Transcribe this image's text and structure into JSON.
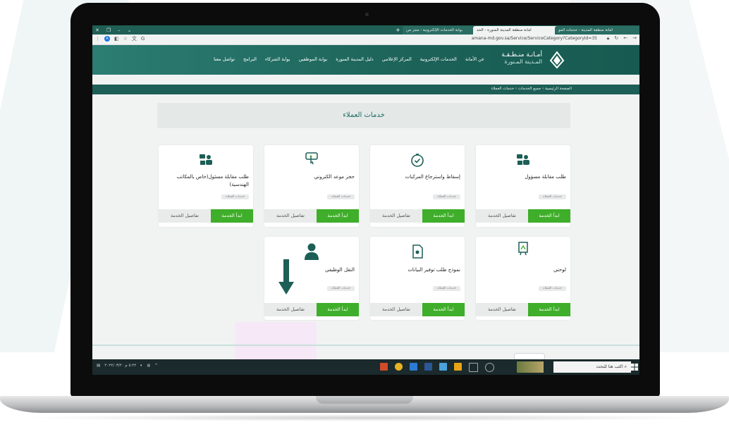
{
  "browser": {
    "tabs": [
      {
        "label": "امانة منطقة المدينة - خدمات المو",
        "active": false
      },
      {
        "label": "امانة منطقة المدينة المنورة - الخد",
        "active": true
      },
      {
        "label": "بوابة الخدمات الإلكترونية - مجز من",
        "active": false
      }
    ],
    "url": "amana-md.gov.sa/Service/ServiceCategory?CategoryId=35"
  },
  "header": {
    "logo_line1": "أمـانـة منـطـقـة",
    "logo_line2": "المـدينة المـنورة",
    "nav": [
      "عن الأمانة",
      "الخدمات الإلكترونية",
      "المركز الإعلامي",
      "دليل المدينة المنورة",
      "بوابة الموظفين",
      "بوابة الشركاء",
      "البرامج",
      "تواصل معنا"
    ]
  },
  "breadcrumb": "الصفحة الرئيسية  ›  جميع الخدمات  ›  خدمات العملاء",
  "page_title": "خدمات العملاء",
  "cards": [
    {
      "title": "طلب مقابلة مسؤول",
      "badge": "خدمات العملاء",
      "start": "ابدأ الخدمة",
      "details": "تفاصيل الخدمة",
      "icon": "people-icon"
    },
    {
      "title": "إسقاط واسترجاع المركبات",
      "badge": "خدمات العملاء",
      "start": "ابدأ الخدمة",
      "details": "تفاصيل الخدمة",
      "icon": "clock-check-icon"
    },
    {
      "title": "حجز موعد الكتروني",
      "badge": "خدمات العملاء",
      "start": "ابدأ الخدمة",
      "details": "تفاصيل الخدمة",
      "icon": "touch-screen-icon"
    },
    {
      "title": "طلب مقابلة مسئول(خاص بالمكاتب الهندسية)",
      "badge": "خدمات العملاء",
      "start": "ابدأ الخدمة",
      "details": "تفاصيل الخدمة",
      "icon": "people-icon"
    },
    {
      "title": "لوحتي",
      "badge": "خدمات العملاء",
      "start": "ابدأ الخدمة",
      "details": "تفاصيل الخدمة",
      "icon": "board-icon"
    },
    {
      "title": "نموذج طلب توفير البيانات",
      "badge": "خدمات العملاء",
      "start": "ابدأ الخدمة",
      "details": "تفاصيل الخدمة",
      "icon": "document-icon"
    },
    {
      "title": "النقل الوظيفي",
      "badge": "خدمات العملاء",
      "start": "ابدأ الخدمة",
      "details": "تفاصيل الخدمة",
      "icon": "person-icon"
    }
  ],
  "taskbar": {
    "search_placeholder": "اكتب هنا للبحث",
    "time": "٥:٢٢ م",
    "date": "٢٠٢٢/٠٣/٢٠"
  },
  "colors": {
    "brand": "#1d5f56",
    "accent": "#3fae2a"
  }
}
